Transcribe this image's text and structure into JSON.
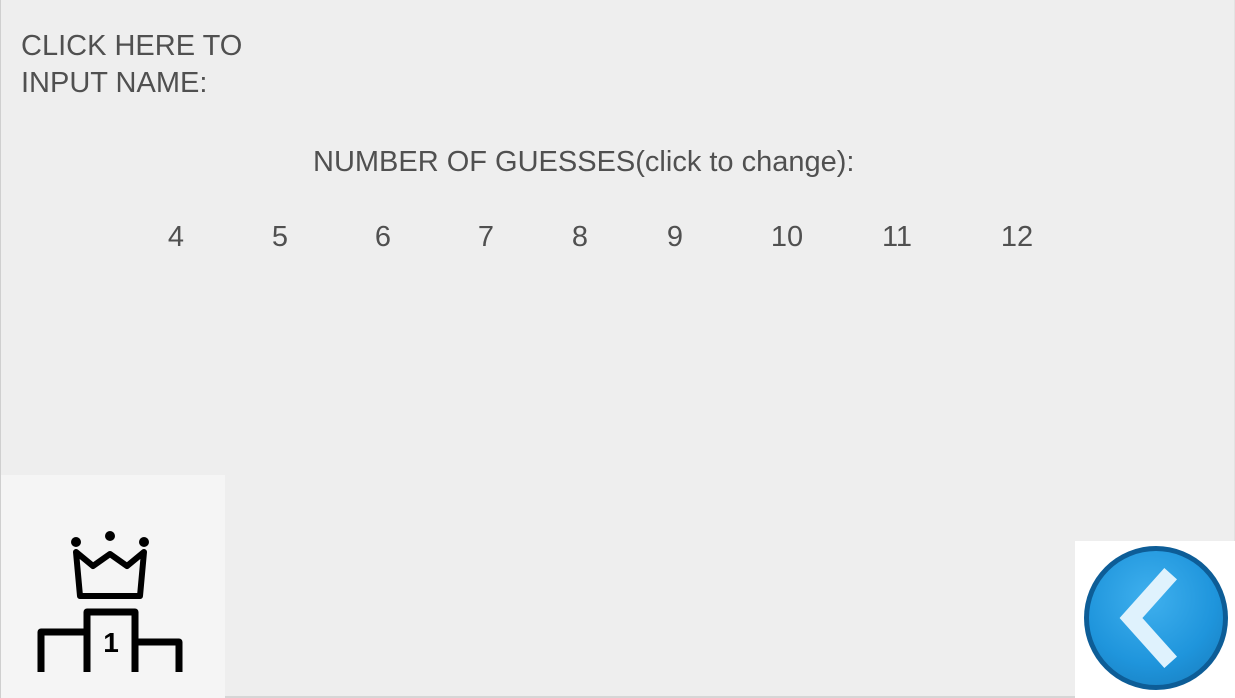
{
  "name_prompt": {
    "label": "CLICK HERE TO\nINPUT NAME:"
  },
  "guesses": {
    "label": "NUMBER OF GUESSES(click to change):",
    "options": [
      "4",
      "5",
      "6",
      "7",
      "8",
      "9",
      "10",
      "11",
      "12"
    ]
  },
  "leaderboard_button": {
    "icon": "podium-crown-icon",
    "podium_number": "1"
  },
  "back_button": {
    "icon": "chevron-left-icon",
    "colors": {
      "fill": "#1f95dc",
      "ring": "#0d5d97"
    }
  }
}
